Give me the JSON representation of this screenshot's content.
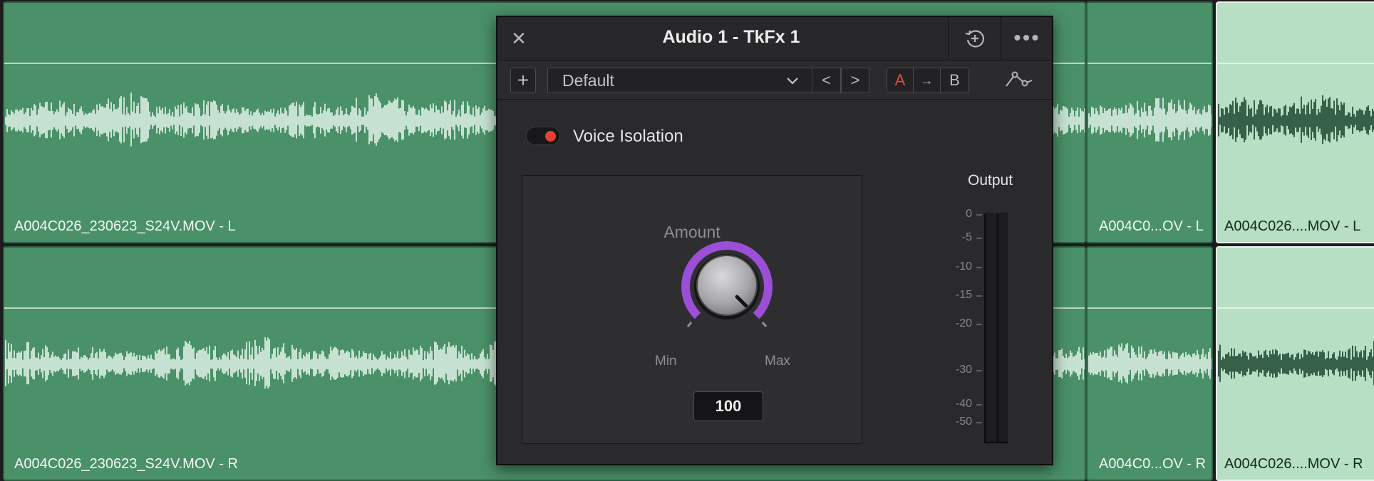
{
  "timeline": {
    "clips": [
      {
        "id": "c1",
        "label": "A004C026_230623_S24V.MOV - L",
        "variant": "dark"
      },
      {
        "id": "c2",
        "label": "A004C026_230623_S24V.MOV - R",
        "variant": "dark"
      },
      {
        "id": "c3",
        "label": "A004C0...OV - L",
        "variant": "dark"
      },
      {
        "id": "c4",
        "label": "A004C0...OV - R",
        "variant": "dark"
      },
      {
        "id": "c5",
        "label": "A004C026....MOV - L",
        "variant": "light"
      },
      {
        "id": "c6",
        "label": "A004C026....MOV - R",
        "variant": "light"
      }
    ]
  },
  "plugin": {
    "title": "Audio 1 - TkFx 1",
    "close_icon": "close-icon",
    "reset_icon": "reset-history-icon",
    "more_icon": "more-options-icon",
    "toolbar": {
      "add_label": "+",
      "preset": "Default",
      "prev_label": "<",
      "next_label": ">",
      "a_label": "A",
      "copy_label": "→",
      "b_label": "B",
      "curve_icon": "automation-curve-icon"
    },
    "effect": {
      "name": "Voice Isolation",
      "enabled": true,
      "amount_label": "Amount",
      "min_label": "Min",
      "max_label": "Max",
      "amount_value": "100",
      "amount_fraction": 1.0
    },
    "output": {
      "label": "Output",
      "scale": [
        "0",
        "-5",
        "-10",
        "-15",
        "-20",
        "-30",
        "-40",
        "-50"
      ]
    },
    "colors": {
      "accent": "#9b4fd6",
      "power": "#e9402f",
      "a_active": "#e64c3c"
    }
  }
}
